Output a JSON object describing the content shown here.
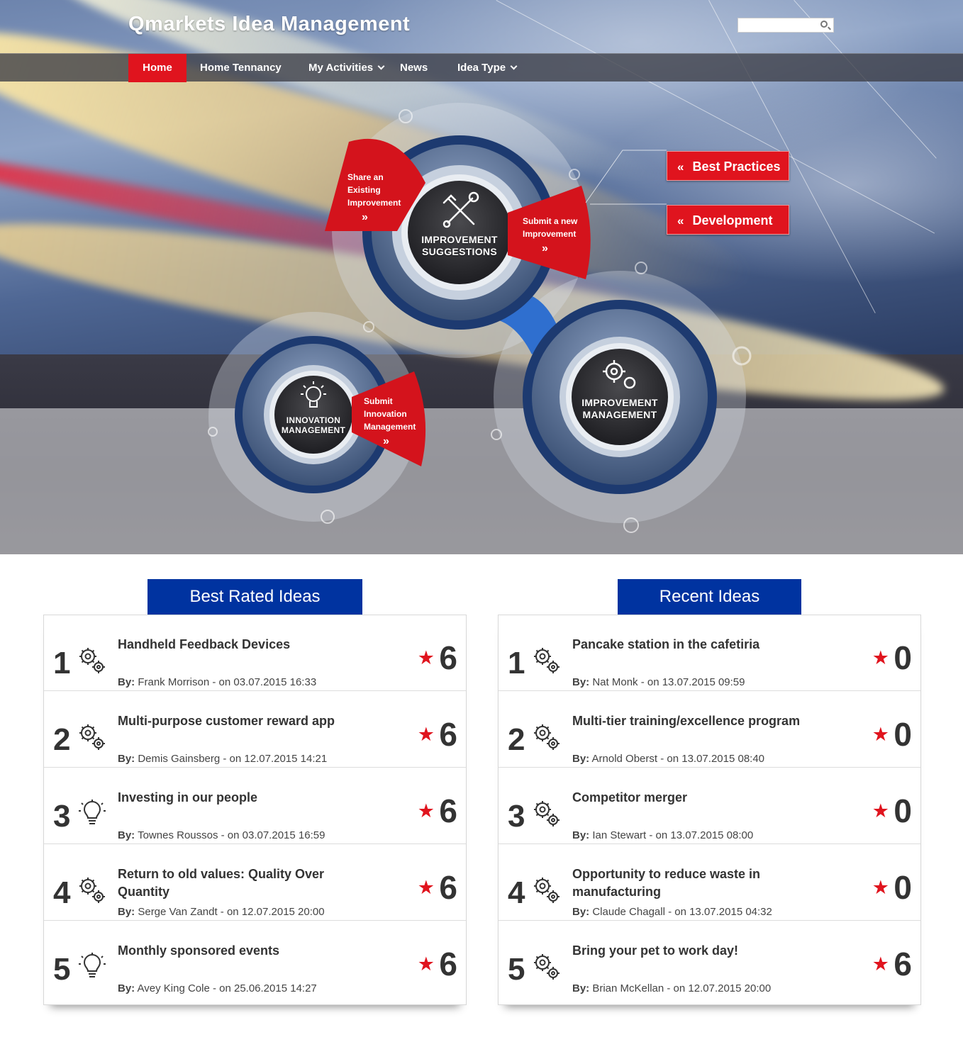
{
  "header": {
    "title": "Qmarkets Idea Management",
    "search_placeholder": ""
  },
  "nav": {
    "items": [
      {
        "label": "Home",
        "active": true
      },
      {
        "label": "Home Tennancy"
      },
      {
        "label": "My Activities",
        "dropdown": true
      },
      {
        "label": "News"
      },
      {
        "label": "Idea Type",
        "dropdown": true
      }
    ]
  },
  "graphic": {
    "hubs": {
      "improvement_suggestions": "IMPROVEMENT SUGGESTIONS",
      "innovation_management": "INNOVATION MANAGEMENT",
      "improvement_management": "IMPROVEMENT MANAGEMENT"
    },
    "segments": {
      "share_existing": "Share an Existing Improvement",
      "submit_new": "Submit a new Improvement",
      "submit_innovation": "Submit Innovation Management"
    },
    "arrow": "»",
    "buttons": [
      "Best Practices",
      "Development"
    ],
    "button_prefix": "«"
  },
  "colors": {
    "accent_red": "#e0141e",
    "header_blue": "#0033a0"
  },
  "best_rated": {
    "title": "Best Rated Ideas",
    "rows": [
      {
        "rank": "1",
        "icon": "gears-icon",
        "title": "Handheld Feedback Devices",
        "by_label": "By:",
        "by": "Frank Morrison - on 03.07.2015 16:33",
        "score": "6"
      },
      {
        "rank": "2",
        "icon": "gears-icon",
        "title": "Multi-purpose customer reward app",
        "by_label": "By:",
        "by": "Demis Gainsberg - on 12.07.2015 14:21",
        "score": "6"
      },
      {
        "rank": "3",
        "icon": "lightbulb-icon",
        "title": "Investing in our people",
        "by_label": "By:",
        "by": "Townes Roussos - on 03.07.2015 16:59",
        "score": "6"
      },
      {
        "rank": "4",
        "icon": "gears-icon",
        "title": "Return to old values: Quality Over Quantity",
        "by_label": "By:",
        "by": "Serge Van Zandt - on 12.07.2015 20:00",
        "score": "6"
      },
      {
        "rank": "5",
        "icon": "lightbulb-icon",
        "title": "Monthly sponsored events",
        "by_label": "By:",
        "by": "Avey King Cole - on 25.06.2015 14:27",
        "score": "6"
      }
    ]
  },
  "recent": {
    "title": "Recent Ideas",
    "rows": [
      {
        "rank": "1",
        "icon": "gears-icon",
        "title": "Pancake station in the cafetiria",
        "by_label": "By:",
        "by": "Nat Monk - on 13.07.2015 09:59",
        "score": "0"
      },
      {
        "rank": "2",
        "icon": "gears-icon",
        "title": "Multi-tier training/excellence program",
        "by_label": "By:",
        "by": "Arnold Oberst - on 13.07.2015 08:40",
        "score": "0"
      },
      {
        "rank": "3",
        "icon": "gears-icon",
        "title": "Competitor merger",
        "by_label": "By:",
        "by": "Ian Stewart - on 13.07.2015 08:00",
        "score": "0"
      },
      {
        "rank": "4",
        "icon": "gears-icon",
        "title": "Opportunity to reduce waste in manufacturing",
        "by_label": "By:",
        "by": "Claude Chagall - on 13.07.2015 04:32",
        "score": "0"
      },
      {
        "rank": "5",
        "icon": "gears-icon",
        "title": "Bring your pet to work day!",
        "by_label": "By:",
        "by": "Brian McKellan - on 12.07.2015 20:00",
        "score": "6"
      }
    ]
  }
}
